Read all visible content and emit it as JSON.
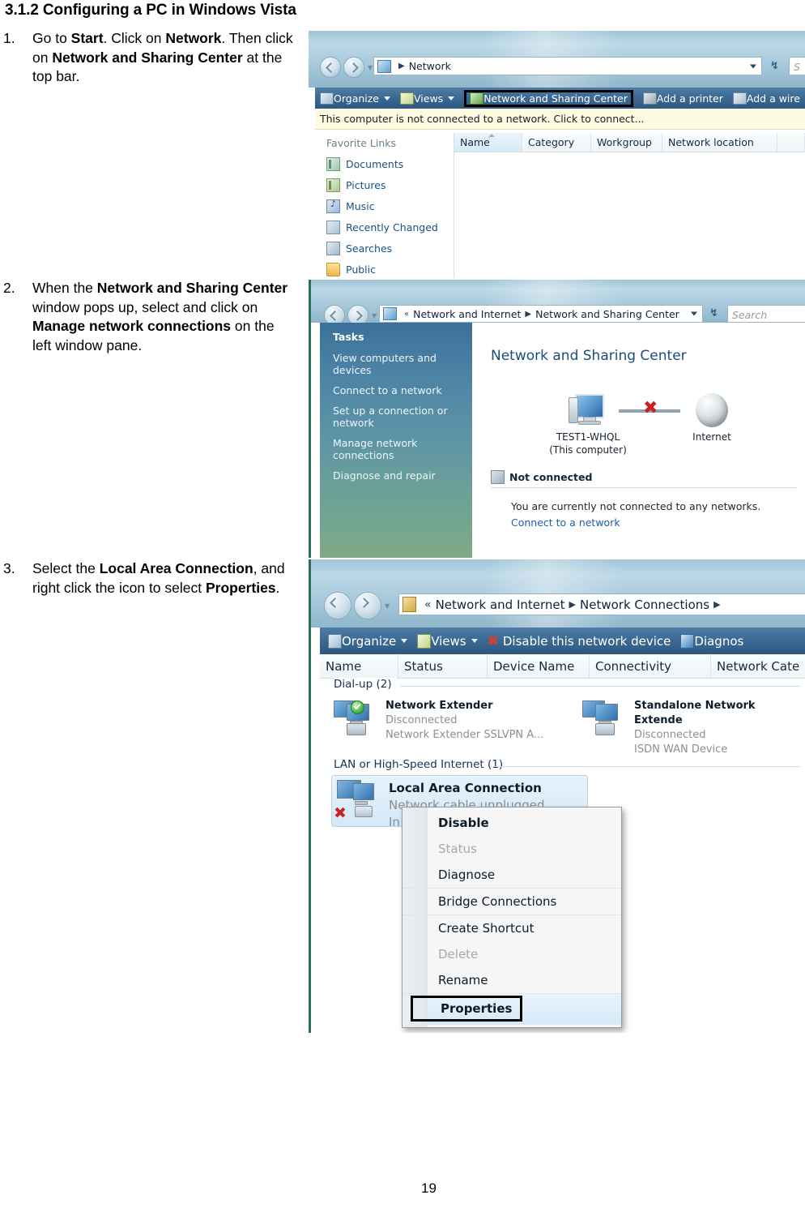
{
  "document": {
    "heading": "3.1.2 Configuring a PC in Windows Vista",
    "page_number": "19"
  },
  "steps": [
    {
      "number": "1.",
      "segments": [
        {
          "text": "Go to ",
          "bold": false
        },
        {
          "text": "Start",
          "bold": true
        },
        {
          "text": ". Click on ",
          "bold": false
        },
        {
          "text": "Network",
          "bold": true
        },
        {
          "text": ". Then click on ",
          "bold": false
        },
        {
          "text": "Network and Sharing Center",
          "bold": true
        },
        {
          "text": " at the top bar.",
          "bold": false
        }
      ]
    },
    {
      "number": "2.",
      "segments": [
        {
          "text": "When the ",
          "bold": false
        },
        {
          "text": "Network and Sharing Center",
          "bold": true
        },
        {
          "text": " window pops up, select and click on ",
          "bold": false
        },
        {
          "text": "Manage network connections",
          "bold": true
        },
        {
          "text": " on the left window pane.",
          "bold": false
        }
      ]
    },
    {
      "number": "3.",
      "segments": [
        {
          "text": "Select the ",
          "bold": false
        },
        {
          "text": "Local Area Connection",
          "bold": true
        },
        {
          "text": ", and right click the icon to select ",
          "bold": false
        },
        {
          "text": "Properties",
          "bold": true
        },
        {
          "text": ".",
          "bold": false
        }
      ]
    }
  ],
  "screenshot1": {
    "address": {
      "crumbs": [
        "Network"
      ],
      "icon": "network-icon"
    },
    "search_placeholder": "S",
    "toolbar": {
      "organize": "Organize",
      "views": "Views",
      "network_sharing_center": "Network and Sharing Center",
      "add_printer": "Add a printer",
      "add_wireless": "Add a wire"
    },
    "info_bar": "This computer is not connected to a network. Click to connect...",
    "columns": [
      "Name",
      "Category",
      "Workgroup",
      "Network location"
    ],
    "nav_pane": {
      "title": "Favorite Links",
      "items": [
        {
          "label": "Documents",
          "icon": "documents-icon"
        },
        {
          "label": "Pictures",
          "icon": "pictures-icon"
        },
        {
          "label": "Music",
          "icon": "music-icon"
        },
        {
          "label": "Recently Changed",
          "icon": "recently-changed-icon"
        },
        {
          "label": "Searches",
          "icon": "searches-icon"
        },
        {
          "label": "Public",
          "icon": "public-folder-icon"
        }
      ]
    }
  },
  "screenshot2": {
    "address": {
      "chevrons": "«",
      "crumbs": [
        "Network and Internet",
        "Network and Sharing Center"
      ]
    },
    "search_placeholder": "Search",
    "task_pane": {
      "title": "Tasks",
      "items": [
        "View computers and devices",
        "Connect to a network",
        "Set up a connection or network",
        "Manage network connections",
        "Diagnose and repair"
      ]
    },
    "page_title": "Network and Sharing Center",
    "map": {
      "computer_name": "TEST1-WHQL",
      "computer_sub": "(This computer)",
      "internet_label": "Internet",
      "link_status": "broken"
    },
    "status_heading": "Not connected",
    "status_text": "You are currently not connected to any networks.",
    "status_link": "Connect to a network"
  },
  "screenshot3": {
    "address": {
      "chevrons": "«",
      "crumbs": [
        "Network and Internet",
        "Network Connections"
      ]
    },
    "toolbar": {
      "organize": "Organize",
      "views": "Views",
      "disable_device": "Disable this network device",
      "diagnose": "Diagnos"
    },
    "columns": [
      "Name",
      "Status",
      "Device Name",
      "Connectivity",
      "Network Cate"
    ],
    "groups": [
      {
        "label": "Dial-up (2)",
        "connections": [
          {
            "name": "Network Extender",
            "status": "Disconnected",
            "device": "Network Extender SSLVPN A...",
            "badge": "green-check"
          },
          {
            "name": "Standalone Network Extende",
            "status": "Disconnected",
            "device": "ISDN WAN Device",
            "badge": "none"
          }
        ]
      },
      {
        "label": "LAN or High-Speed Internet (1)",
        "connections": [
          {
            "name": "Local Area Connection",
            "status": "Network cable unplugged",
            "device": "In",
            "badge": "red-x",
            "selected": true
          }
        ]
      }
    ],
    "context_menu": [
      {
        "label": "Disable",
        "disabled": false,
        "separator_after": false,
        "highlight": false
      },
      {
        "label": "Status",
        "disabled": true,
        "separator_after": false,
        "highlight": false
      },
      {
        "label": "Diagnose",
        "disabled": false,
        "separator_after": true,
        "highlight": false
      },
      {
        "label": "Bridge Connections",
        "disabled": false,
        "separator_after": true,
        "highlight": false
      },
      {
        "label": "Create Shortcut",
        "disabled": false,
        "separator_after": false,
        "highlight": false
      },
      {
        "label": "Delete",
        "disabled": true,
        "separator_after": false,
        "highlight": false
      },
      {
        "label": "Rename",
        "disabled": false,
        "separator_after": true,
        "highlight": false
      },
      {
        "label": "Properties",
        "disabled": false,
        "separator_after": false,
        "highlight": true
      }
    ]
  },
  "colors": {
    "toolbar_blue": "#3f6c95",
    "glass_blue": "#a9cbdd",
    "info_bar_yellow": "#fdfbe2",
    "link_blue": "#1e5fa8",
    "accent_red": "#cc2222",
    "task_pane_top": "#3b6f99",
    "task_pane_bottom": "#7faa86"
  }
}
